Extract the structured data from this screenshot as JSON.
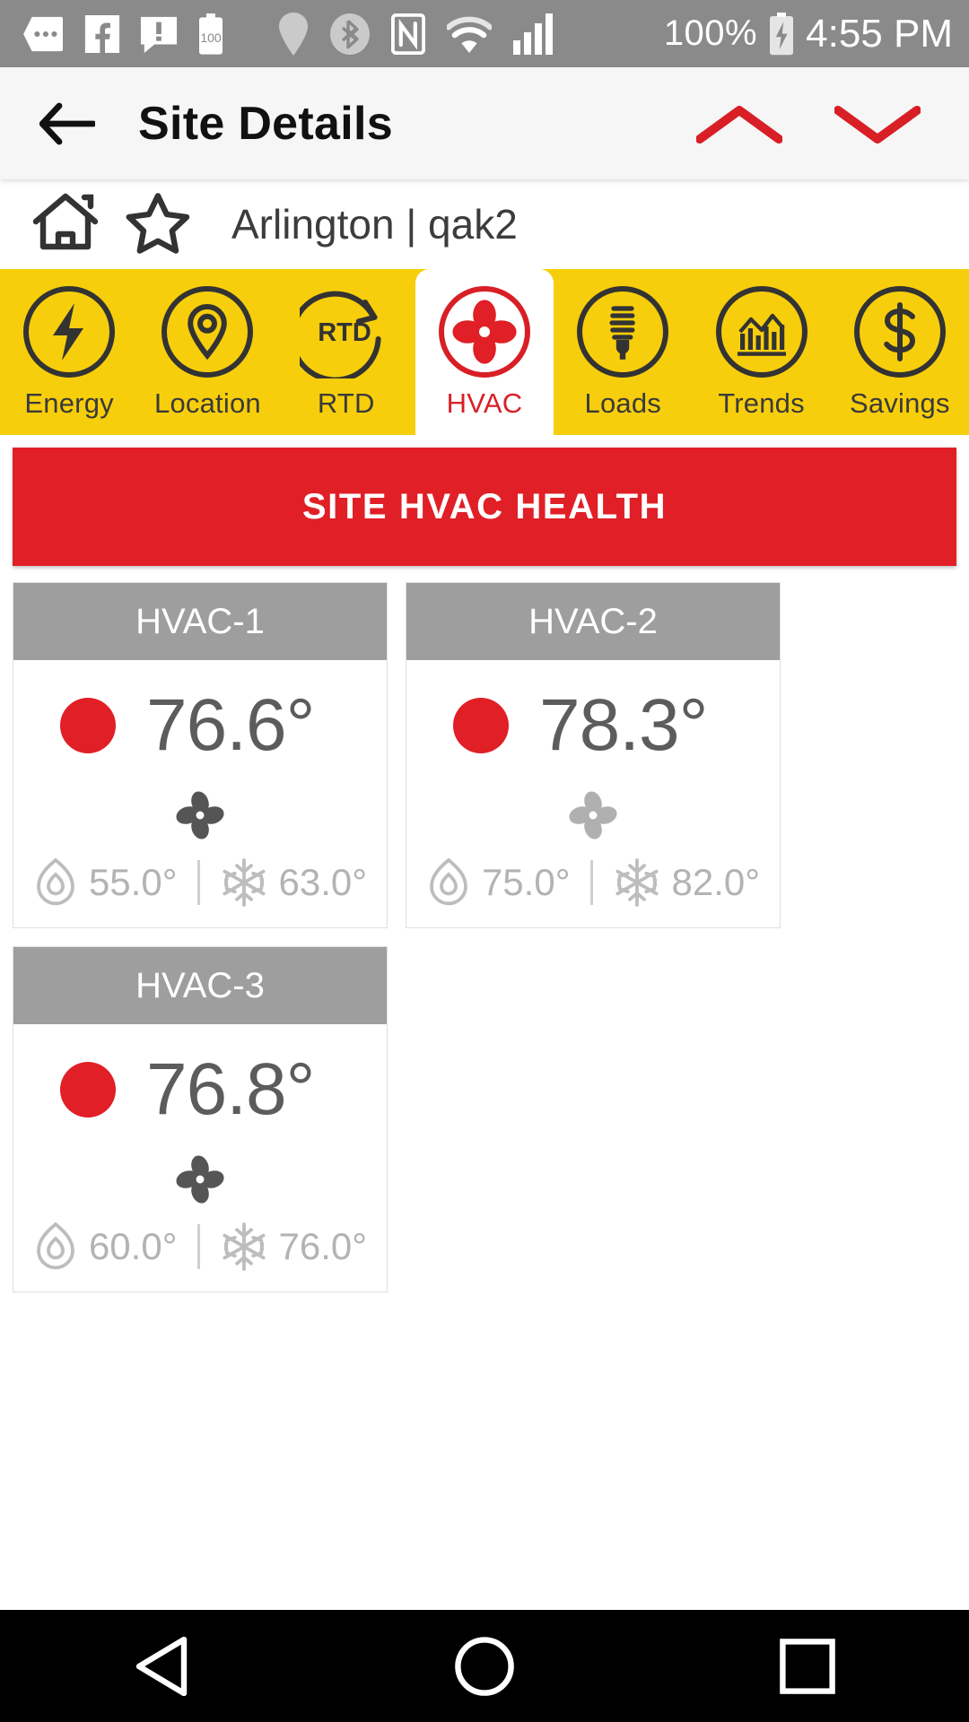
{
  "statusbar": {
    "icons_left": [
      "message-dots-icon",
      "facebook-icon",
      "message-alert-icon",
      "battery-100-icon"
    ],
    "icons_mid": [
      "location-pin-icon",
      "bluetooth-icon",
      "nfc-icon",
      "wifi-icon",
      "signal-bars-icon"
    ],
    "battery_percent": "100%",
    "charging_icon": "battery-charging-icon",
    "time": "4:55 PM",
    "background": "#8a8a8a"
  },
  "appbar": {
    "back_icon": "back-arrow-icon",
    "title": "Site Details",
    "collapse_icon": "chevron-up-icon",
    "expand_icon": "chevron-down-icon",
    "accent": "#d81f26"
  },
  "breadcrumb": {
    "home_icon": "home-icon",
    "favorite_icon": "star-outline-icon",
    "text": "Arlington | qak2"
  },
  "tabs": {
    "active_index": 3,
    "bar_color": "#f7ce0b",
    "items": [
      {
        "label": "Energy",
        "icon": "lightning-bolt-icon"
      },
      {
        "label": "Location",
        "icon": "location-pin-icon"
      },
      {
        "label": "RTD",
        "icon": "rtd-refresh-icon"
      },
      {
        "label": "HVAC",
        "icon": "fan-icon"
      },
      {
        "label": "Loads",
        "icon": "light-bulb-icon"
      },
      {
        "label": "Trends",
        "icon": "bar-chart-icon"
      },
      {
        "label": "Savings",
        "icon": "dollar-sign-icon"
      }
    ]
  },
  "banner": {
    "text": "SITE HVAC HEALTH",
    "color": "#e01f26"
  },
  "hvac_cards": [
    {
      "title": "HVAC-1",
      "status_color": "#e01f26",
      "temperature": "76.6°",
      "fan_active": true,
      "heat_icon": "flame-icon",
      "heat_setpoint": "55.0°",
      "cool_icon": "snowflake-icon",
      "cool_setpoint": "63.0°"
    },
    {
      "title": "HVAC-2",
      "status_color": "#e01f26",
      "temperature": "78.3°",
      "fan_active": false,
      "heat_icon": "flame-icon",
      "heat_setpoint": "75.0°",
      "cool_icon": "snowflake-icon",
      "cool_setpoint": "82.0°"
    },
    {
      "title": "HVAC-3",
      "status_color": "#e01f26",
      "temperature": "76.8°",
      "fan_active": true,
      "heat_icon": "flame-icon",
      "heat_setpoint": "60.0°",
      "cool_icon": "snowflake-icon",
      "cool_setpoint": "76.0°"
    }
  ],
  "navbar": {
    "back_icon": "nav-back-triangle-icon",
    "home_icon": "nav-home-circle-icon",
    "recents_icon": "nav-recents-square-icon"
  }
}
